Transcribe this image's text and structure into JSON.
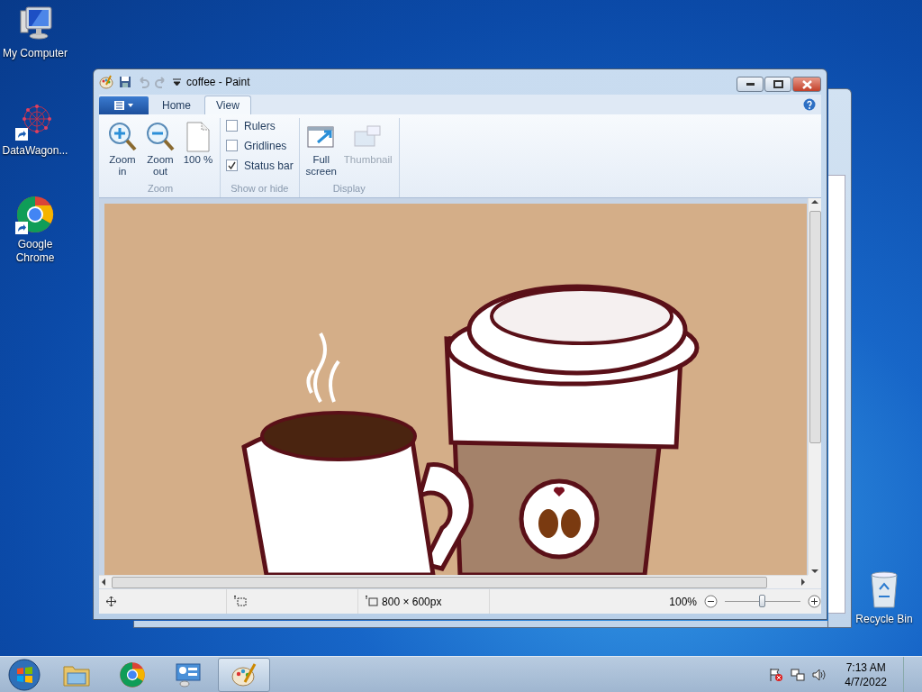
{
  "desktop_icons": [
    {
      "label": "My Computer",
      "kind": "computer",
      "shortcut": false
    },
    {
      "label": "DataWagon...",
      "kind": "network",
      "shortcut": true
    },
    {
      "label": "Google Chrome",
      "kind": "chrome",
      "shortcut": true
    },
    {
      "label": "Recycle Bin",
      "kind": "recycle",
      "shortcut": false
    }
  ],
  "window": {
    "title": "coffee - Paint",
    "tabs": [
      {
        "label": "Home",
        "selected": false
      },
      {
        "label": "View",
        "selected": true
      }
    ],
    "ribbon_groups": [
      {
        "label": "Zoom",
        "items": [
          {
            "kind": "zoom-in",
            "label": "Zoom in",
            "disabled": false
          },
          {
            "kind": "zoom-out",
            "label": "Zoom out",
            "disabled": false
          },
          {
            "kind": "actual-size",
            "label": "100 %",
            "disabled": false
          }
        ]
      },
      {
        "label": "Show or hide",
        "items": [
          {
            "kind": "checkbox",
            "label": "Rulers",
            "checked": false
          },
          {
            "kind": "checkbox",
            "label": "Gridlines",
            "checked": false
          },
          {
            "kind": "checkbox",
            "label": "Status bar",
            "checked": true
          }
        ]
      },
      {
        "label": "Display",
        "items": [
          {
            "kind": "full-screen",
            "label": "Full screen",
            "disabled": false
          },
          {
            "kind": "thumbnail",
            "label": "Thumbnail",
            "disabled": true
          }
        ]
      }
    ],
    "status_bar": {
      "image_size": "800 × 600px",
      "zoom": "100%",
      "zoom_slider": {
        "level": 0.5
      }
    }
  },
  "taskbar": {
    "items": [
      {
        "kind": "explorer",
        "selected": false
      },
      {
        "kind": "chrome",
        "selected": false
      },
      {
        "kind": "control-panel",
        "selected": false
      },
      {
        "kind": "paint",
        "selected": true
      }
    ],
    "clock": {
      "time": "7:13 AM",
      "date": "4/7/2022"
    }
  }
}
